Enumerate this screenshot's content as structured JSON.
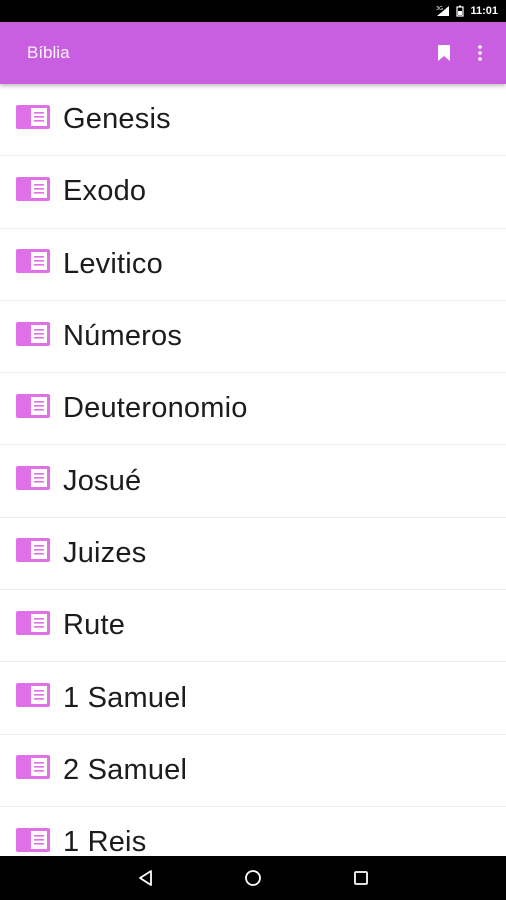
{
  "status_bar": {
    "time": "11:01",
    "icons": [
      "signal-icon",
      "battery-icon"
    ]
  },
  "app_bar": {
    "title": "Bíblia",
    "actions": [
      {
        "name": "bookmark-icon"
      },
      {
        "name": "more-vert-icon"
      }
    ]
  },
  "colors": {
    "accent": "#c95fe0",
    "icon": "#e070e8",
    "status_bar": "#000000"
  },
  "books": [
    {
      "label": "Genesis"
    },
    {
      "label": "Exodo"
    },
    {
      "label": "Levitico"
    },
    {
      "label": "Números"
    },
    {
      "label": "Deuteronomio"
    },
    {
      "label": "Josué"
    },
    {
      "label": "Juizes"
    },
    {
      "label": "Rute"
    },
    {
      "label": "1 Samuel"
    },
    {
      "label": "2 Samuel"
    },
    {
      "label": "1 Reis"
    }
  ],
  "nav_bar": {
    "buttons": [
      "back-icon",
      "home-icon",
      "recents-icon"
    ]
  }
}
